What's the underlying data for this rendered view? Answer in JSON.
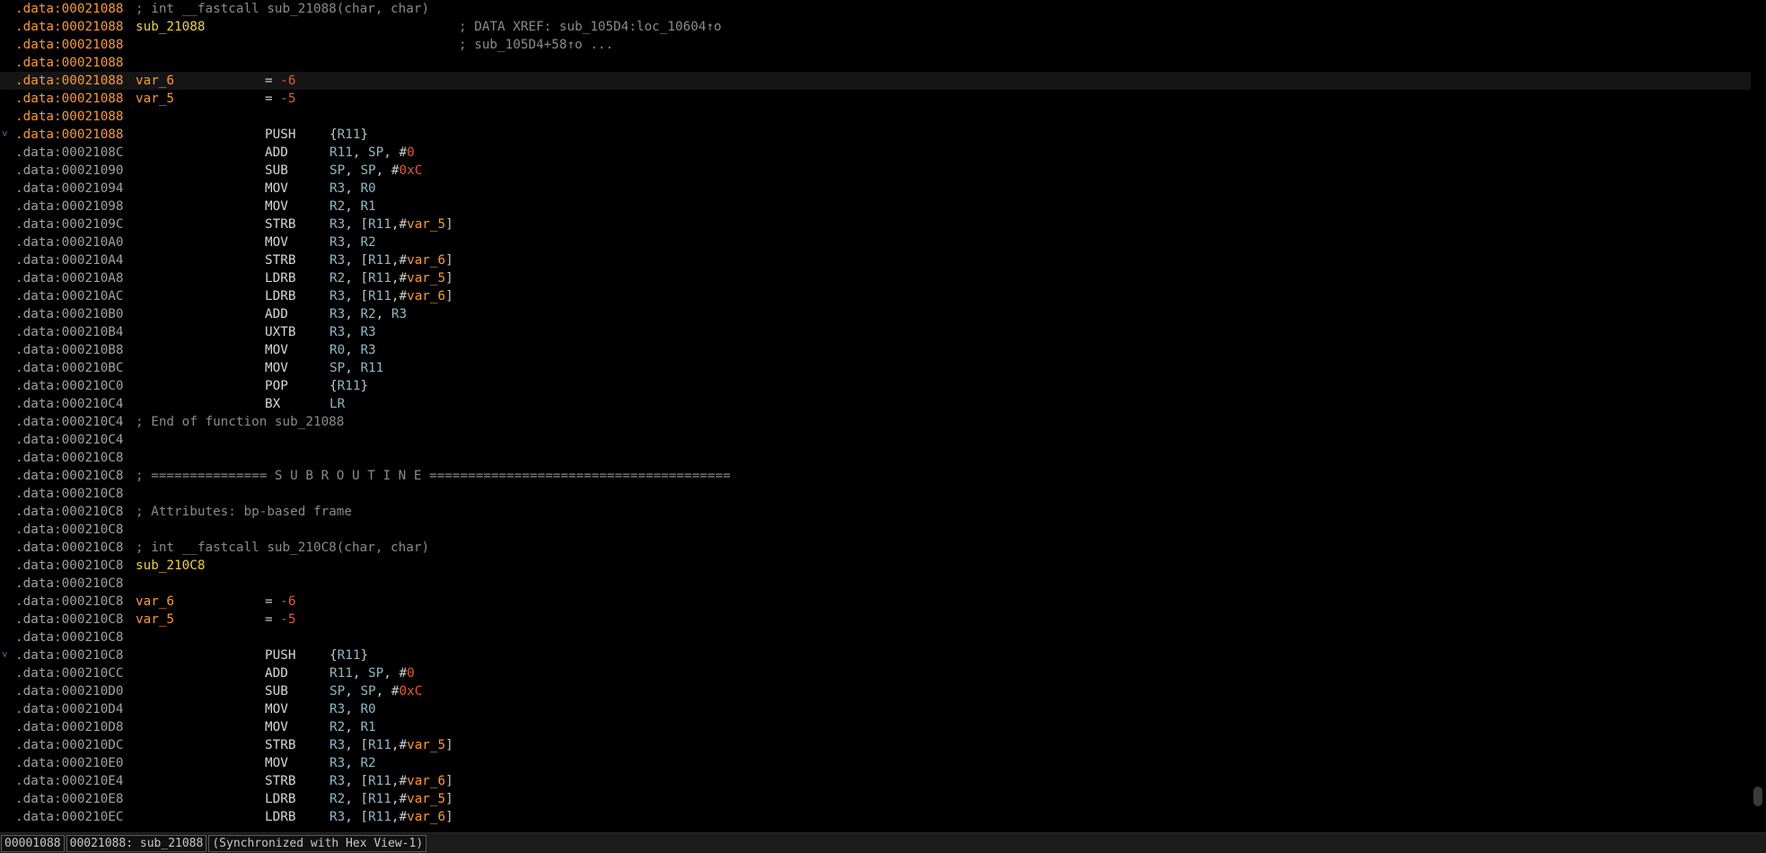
{
  "lines": [
    {
      "seg": ".data",
      "addr": "00021088",
      "func": true,
      "kind": "comment",
      "text": "; int __fastcall sub_21088(char, char)"
    },
    {
      "seg": ".data",
      "addr": "00021088",
      "func": true,
      "kind": "label",
      "label": "sub_21088",
      "xref": "; DATA XREF: sub_105D4:loc_10604↑o"
    },
    {
      "seg": ".data",
      "addr": "00021088",
      "func": true,
      "kind": "xrefonly",
      "xref": "; sub_105D4+58↑o ..."
    },
    {
      "seg": ".data",
      "addr": "00021088",
      "func": true,
      "kind": "blank"
    },
    {
      "seg": ".data",
      "addr": "00021088",
      "func": true,
      "kind": "var",
      "name": "var_6",
      "eq": "= ",
      "val": "-6",
      "hl": true
    },
    {
      "seg": ".data",
      "addr": "00021088",
      "func": true,
      "kind": "var",
      "name": "var_5",
      "eq": "= ",
      "val": "-5"
    },
    {
      "seg": ".data",
      "addr": "00021088",
      "func": true,
      "kind": "blank"
    },
    {
      "seg": ".data",
      "addr": "00021088",
      "func": true,
      "kind": "ins",
      "collapse": true,
      "mnem": "PUSH",
      "ops": [
        [
          "p",
          "{"
        ],
        [
          "r",
          "R11"
        ],
        [
          "p",
          "}"
        ]
      ]
    },
    {
      "seg": ".data",
      "addr": "0002108C",
      "kind": "ins",
      "mnem": "ADD",
      "ops": [
        [
          "r",
          "R11"
        ],
        [
          "p",
          ", "
        ],
        [
          "r",
          "SP"
        ],
        [
          "p",
          ", #"
        ],
        [
          "n",
          "0"
        ]
      ]
    },
    {
      "seg": ".data",
      "addr": "00021090",
      "kind": "ins",
      "mnem": "SUB",
      "ops": [
        [
          "r",
          "SP"
        ],
        [
          "p",
          ", "
        ],
        [
          "r",
          "SP"
        ],
        [
          "p",
          ", #"
        ],
        [
          "n",
          "0xC"
        ]
      ]
    },
    {
      "seg": ".data",
      "addr": "00021094",
      "kind": "ins",
      "mnem": "MOV",
      "ops": [
        [
          "r",
          "R3"
        ],
        [
          "p",
          ", "
        ],
        [
          "r",
          "R0"
        ]
      ]
    },
    {
      "seg": ".data",
      "addr": "00021098",
      "kind": "ins",
      "mnem": "MOV",
      "ops": [
        [
          "r",
          "R2"
        ],
        [
          "p",
          ", "
        ],
        [
          "r",
          "R1"
        ]
      ]
    },
    {
      "seg": ".data",
      "addr": "0002109C",
      "kind": "ins",
      "mnem": "STRB",
      "ops": [
        [
          "r",
          "R3"
        ],
        [
          "p",
          ", ["
        ],
        [
          "r",
          "R11"
        ],
        [
          "p",
          ",#"
        ],
        [
          "v",
          "var_5"
        ],
        [
          "p",
          "]"
        ]
      ]
    },
    {
      "seg": ".data",
      "addr": "000210A0",
      "kind": "ins",
      "mnem": "MOV",
      "ops": [
        [
          "r",
          "R3"
        ],
        [
          "p",
          ", "
        ],
        [
          "r",
          "R2"
        ]
      ]
    },
    {
      "seg": ".data",
      "addr": "000210A4",
      "kind": "ins",
      "mnem": "STRB",
      "ops": [
        [
          "r",
          "R3"
        ],
        [
          "p",
          ", ["
        ],
        [
          "r",
          "R11"
        ],
        [
          "p",
          ",#"
        ],
        [
          "v",
          "var_6"
        ],
        [
          "p",
          "]"
        ]
      ]
    },
    {
      "seg": ".data",
      "addr": "000210A8",
      "kind": "ins",
      "mnem": "LDRB",
      "ops": [
        [
          "r",
          "R2"
        ],
        [
          "p",
          ", ["
        ],
        [
          "r",
          "R11"
        ],
        [
          "p",
          ",#"
        ],
        [
          "v",
          "var_5"
        ],
        [
          "p",
          "]"
        ]
      ]
    },
    {
      "seg": ".data",
      "addr": "000210AC",
      "kind": "ins",
      "mnem": "LDRB",
      "ops": [
        [
          "r",
          "R3"
        ],
        [
          "p",
          ", ["
        ],
        [
          "r",
          "R11"
        ],
        [
          "p",
          ",#"
        ],
        [
          "v",
          "var_6"
        ],
        [
          "p",
          "]"
        ]
      ]
    },
    {
      "seg": ".data",
      "addr": "000210B0",
      "kind": "ins",
      "mnem": "ADD",
      "ops": [
        [
          "r",
          "R3"
        ],
        [
          "p",
          ", "
        ],
        [
          "r",
          "R2"
        ],
        [
          "p",
          ", "
        ],
        [
          "r",
          "R3"
        ]
      ]
    },
    {
      "seg": ".data",
      "addr": "000210B4",
      "kind": "ins",
      "mnem": "UXTB",
      "ops": [
        [
          "r",
          "R3"
        ],
        [
          "p",
          ", "
        ],
        [
          "r",
          "R3"
        ]
      ]
    },
    {
      "seg": ".data",
      "addr": "000210B8",
      "kind": "ins",
      "mnem": "MOV",
      "ops": [
        [
          "r",
          "R0"
        ],
        [
          "p",
          ", "
        ],
        [
          "r",
          "R3"
        ]
      ]
    },
    {
      "seg": ".data",
      "addr": "000210BC",
      "kind": "ins",
      "mnem": "MOV",
      "ops": [
        [
          "r",
          "SP"
        ],
        [
          "p",
          ", "
        ],
        [
          "r",
          "R11"
        ]
      ]
    },
    {
      "seg": ".data",
      "addr": "000210C0",
      "kind": "ins",
      "mnem": "POP",
      "ops": [
        [
          "p",
          "{"
        ],
        [
          "r",
          "R11"
        ],
        [
          "p",
          "}"
        ]
      ]
    },
    {
      "seg": ".data",
      "addr": "000210C4",
      "kind": "ins",
      "mnem": "BX",
      "ops": [
        [
          "r",
          "LR"
        ]
      ]
    },
    {
      "seg": ".data",
      "addr": "000210C4",
      "kind": "comment",
      "text": "; End of function sub_21088"
    },
    {
      "seg": ".data",
      "addr": "000210C4",
      "kind": "blank"
    },
    {
      "seg": ".data",
      "addr": "000210C8",
      "kind": "blank"
    },
    {
      "seg": ".data",
      "addr": "000210C8",
      "kind": "comment",
      "text": "; =============== S U B R O U T I N E ======================================="
    },
    {
      "seg": ".data",
      "addr": "000210C8",
      "kind": "blank"
    },
    {
      "seg": ".data",
      "addr": "000210C8",
      "kind": "comment",
      "text": "; Attributes: bp-based frame"
    },
    {
      "seg": ".data",
      "addr": "000210C8",
      "kind": "blank"
    },
    {
      "seg": ".data",
      "addr": "000210C8",
      "kind": "comment",
      "text": "; int __fastcall sub_210C8(char, char)"
    },
    {
      "seg": ".data",
      "addr": "000210C8",
      "kind": "label",
      "label": "sub_210C8"
    },
    {
      "seg": ".data",
      "addr": "000210C8",
      "kind": "blank"
    },
    {
      "seg": ".data",
      "addr": "000210C8",
      "kind": "var",
      "name": "var_6",
      "eq": "= ",
      "val": "-6"
    },
    {
      "seg": ".data",
      "addr": "000210C8",
      "kind": "var",
      "name": "var_5",
      "eq": "= ",
      "val": "-5"
    },
    {
      "seg": ".data",
      "addr": "000210C8",
      "kind": "blank"
    },
    {
      "seg": ".data",
      "addr": "000210C8",
      "kind": "ins",
      "collapse": true,
      "mnem": "PUSH",
      "ops": [
        [
          "p",
          "{"
        ],
        [
          "r",
          "R11"
        ],
        [
          "p",
          "}"
        ]
      ]
    },
    {
      "seg": ".data",
      "addr": "000210CC",
      "kind": "ins",
      "mnem": "ADD",
      "ops": [
        [
          "r",
          "R11"
        ],
        [
          "p",
          ", "
        ],
        [
          "r",
          "SP"
        ],
        [
          "p",
          ", #"
        ],
        [
          "n",
          "0"
        ]
      ]
    },
    {
      "seg": ".data",
      "addr": "000210D0",
      "kind": "ins",
      "mnem": "SUB",
      "ops": [
        [
          "r",
          "SP"
        ],
        [
          "p",
          ", "
        ],
        [
          "r",
          "SP"
        ],
        [
          "p",
          ", #"
        ],
        [
          "n",
          "0xC"
        ]
      ]
    },
    {
      "seg": ".data",
      "addr": "000210D4",
      "kind": "ins",
      "mnem": "MOV",
      "ops": [
        [
          "r",
          "R3"
        ],
        [
          "p",
          ", "
        ],
        [
          "r",
          "R0"
        ]
      ]
    },
    {
      "seg": ".data",
      "addr": "000210D8",
      "kind": "ins",
      "mnem": "MOV",
      "ops": [
        [
          "r",
          "R2"
        ],
        [
          "p",
          ", "
        ],
        [
          "r",
          "R1"
        ]
      ]
    },
    {
      "seg": ".data",
      "addr": "000210DC",
      "kind": "ins",
      "mnem": "STRB",
      "ops": [
        [
          "r",
          "R3"
        ],
        [
          "p",
          ", ["
        ],
        [
          "r",
          "R11"
        ],
        [
          "p",
          ",#"
        ],
        [
          "v",
          "var_5"
        ],
        [
          "p",
          "]"
        ]
      ]
    },
    {
      "seg": ".data",
      "addr": "000210E0",
      "kind": "ins",
      "mnem": "MOV",
      "ops": [
        [
          "r",
          "R3"
        ],
        [
          "p",
          ", "
        ],
        [
          "r",
          "R2"
        ]
      ]
    },
    {
      "seg": ".data",
      "addr": "000210E4",
      "kind": "ins",
      "mnem": "STRB",
      "ops": [
        [
          "r",
          "R3"
        ],
        [
          "p",
          ", ["
        ],
        [
          "r",
          "R11"
        ],
        [
          "p",
          ",#"
        ],
        [
          "v",
          "var_6"
        ],
        [
          "p",
          "]"
        ]
      ]
    },
    {
      "seg": ".data",
      "addr": "000210E8",
      "kind": "ins",
      "mnem": "LDRB",
      "ops": [
        [
          "r",
          "R2"
        ],
        [
          "p",
          ", ["
        ],
        [
          "r",
          "R11"
        ],
        [
          "p",
          ",#"
        ],
        [
          "v",
          "var_5"
        ],
        [
          "p",
          "]"
        ]
      ]
    },
    {
      "seg": ".data",
      "addr": "000210EC",
      "kind": "ins",
      "mnem": "LDRB",
      "ops": [
        [
          "r",
          "R3"
        ],
        [
          "p",
          ", ["
        ],
        [
          "r",
          "R11"
        ],
        [
          "p",
          ",#"
        ],
        [
          "v",
          "var_6"
        ],
        [
          "p",
          "]"
        ]
      ]
    }
  ],
  "statusbar": {
    "offset": "00001088",
    "location": "00021088: sub_21088",
    "sync": "(Synchronized with Hex View-1)"
  },
  "colors": {
    "background": "#000000",
    "function_address": "#ff9b1f",
    "address": "#a0a0a0",
    "label": "#f2d12a",
    "number": "#e85a2c",
    "register": "#8fb7c8",
    "comment": "#8a8a8a"
  }
}
